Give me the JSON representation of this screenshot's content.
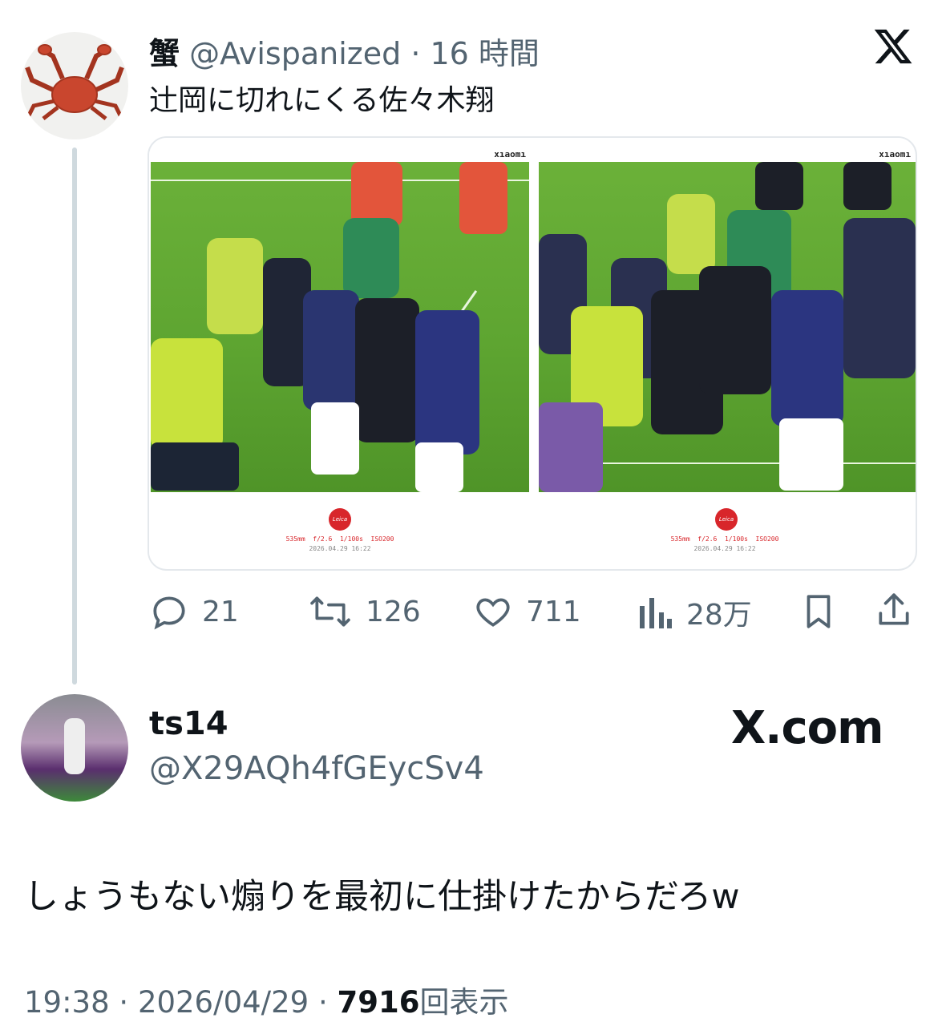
{
  "quoted_tweet": {
    "display_name": "蟹",
    "handle": "@Avispanized",
    "separator": "·",
    "time_ago": "16 時間",
    "text": "辻岡に切れにくる佐々木翔",
    "avatar_icon": "crab-icon",
    "media": [
      {
        "brand": "xıaomı",
        "watermark": "Leica",
        "exif": "535mm  f/2.6  1/100s  ISO200",
        "datetime": "2026.04.29 16:22"
      },
      {
        "brand": "xıaomı",
        "watermark": "Leica",
        "exif": "535mm  f/2.6  1/100s  ISO200",
        "datetime": "2026.04.29 16:22"
      }
    ],
    "actions": {
      "replies": "21",
      "retweets": "126",
      "likes": "711",
      "views": "28万"
    }
  },
  "reply": {
    "display_name": "ts14",
    "handle": "@X29AQh4fGEycSv4",
    "brand_label": "X.com",
    "text": "しょうもない煽りを最初に仕掛けたからだろw",
    "time": "19:38",
    "separator": "·",
    "date": "2026/04/29",
    "view_count": "7916",
    "view_label": "回表示"
  },
  "colors": {
    "text": "#0f1419",
    "muted": "#536471",
    "thread_line": "#cfd9de",
    "pitch": "#5ea531",
    "leica_red": "#d8262b"
  }
}
